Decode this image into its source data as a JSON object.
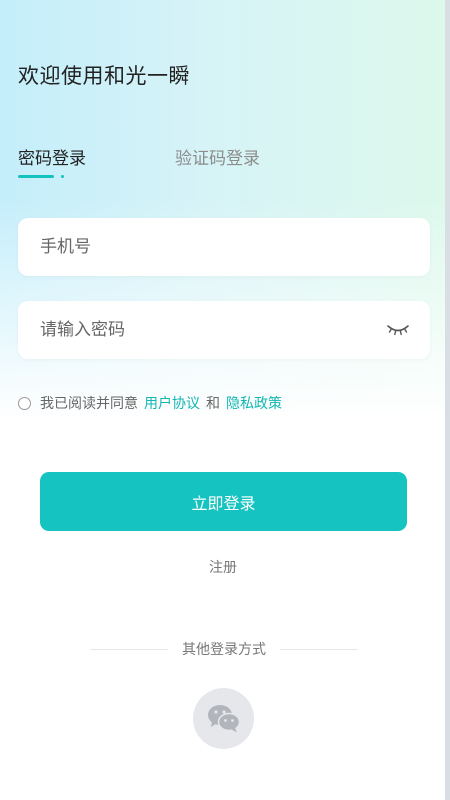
{
  "header": {
    "welcome": "欢迎使用和光一瞬"
  },
  "tabs": [
    {
      "label": "密码登录",
      "active": true
    },
    {
      "label": "验证码登录",
      "active": false
    }
  ],
  "form": {
    "phone_placeholder": "手机号",
    "phone_value": "",
    "password_placeholder": "请输入密码",
    "password_value": ""
  },
  "agreement": {
    "checked": false,
    "prefix": "我已阅读并同意",
    "user_agreement": "用户协议",
    "and": "和",
    "privacy_policy": "隐私政策"
  },
  "actions": {
    "login_label": "立即登录",
    "register_label": "注册"
  },
  "other_login": {
    "label": "其他登录方式",
    "methods": [
      "wechat-icon"
    ]
  },
  "colors": {
    "accent": "#15c4c0",
    "link": "#14b6b3",
    "gradient_left": "#c4eefb",
    "gradient_right": "#ddf9ec"
  }
}
